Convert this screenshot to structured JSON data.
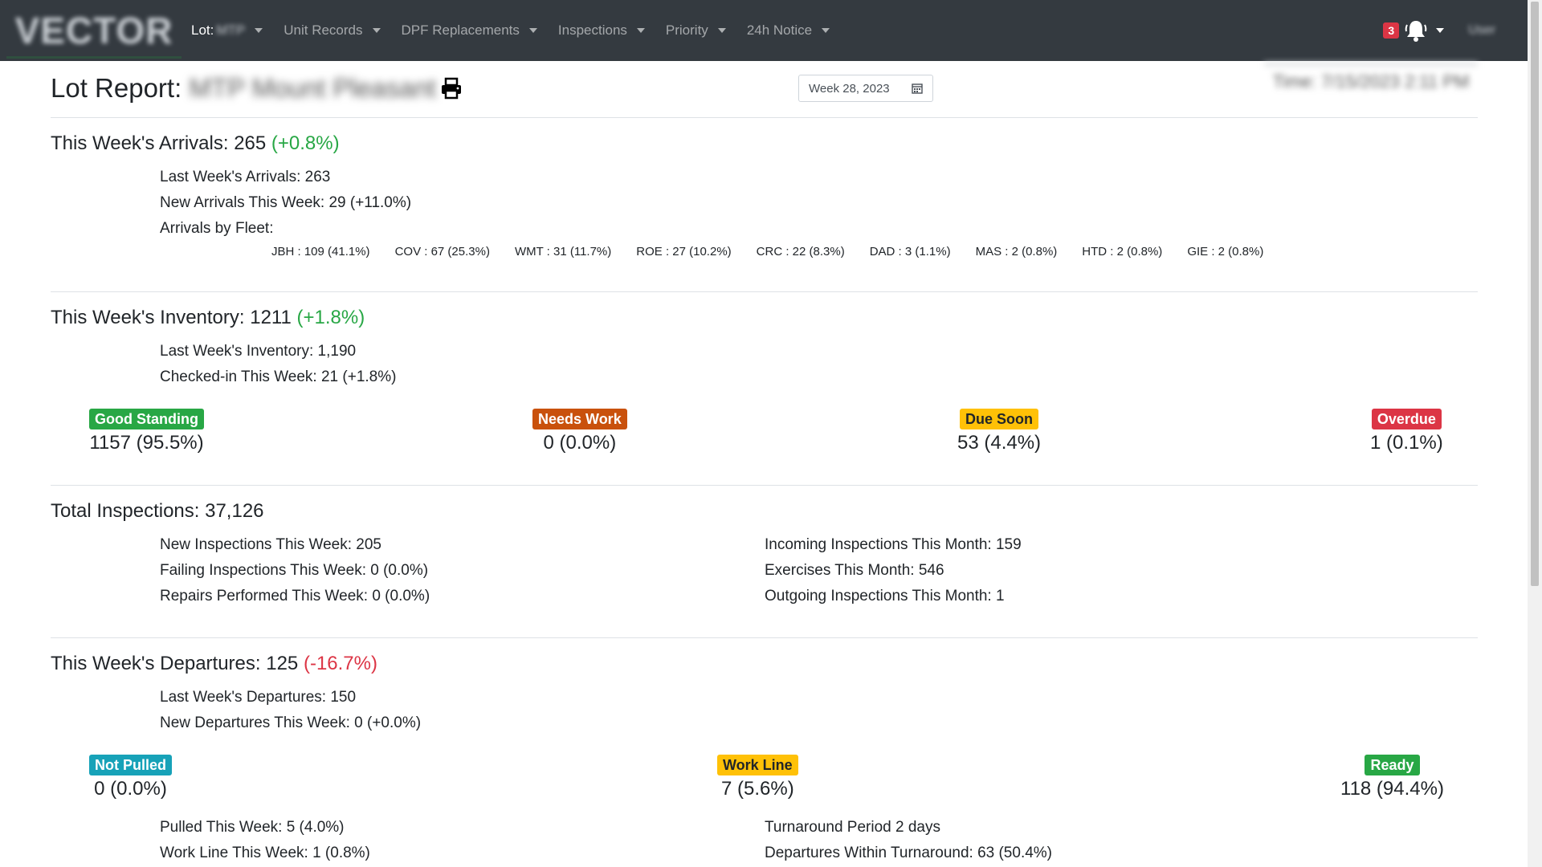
{
  "nav": {
    "brand": "VECTOR",
    "lot_label": "Lot:",
    "lot_value": "MTP",
    "menu": [
      "Unit Records",
      "DPF Replacements",
      "Inspections",
      "Priority",
      "24h Notice"
    ],
    "notification_count": "3",
    "user": "User"
  },
  "header": {
    "title": "Lot Report:",
    "lot_name": "MTP Mount Pleasant",
    "week": "Week 28, 2023",
    "time": "Time: 7/15/2023 2:11 PM"
  },
  "arrivals": {
    "title": "This Week's Arrivals: 265",
    "change": "(+0.8%)",
    "last_week": "Last Week's Arrivals: 263",
    "new": "New Arrivals This Week: 29 (+11.0%)",
    "by_fleet_label": "Arrivals by Fleet:",
    "fleets": [
      "JBH : 109 (41.1%)",
      "COV : 67 (25.3%)",
      "WMT : 31 (11.7%)",
      "ROE : 27 (10.2%)",
      "CRC : 22 (8.3%)",
      "DAD : 3 (1.1%)",
      "MAS : 2 (0.8%)",
      "HTD : 2 (0.8%)",
      "GIE : 2 (0.8%)"
    ]
  },
  "inventory": {
    "title": "This Week's Inventory: 1211",
    "change": "(+1.8%)",
    "last_week": "Last Week's Inventory: 1,190",
    "checked_in": "Checked-in This Week: 21 (+1.8%)",
    "stats": [
      {
        "label": "Good Standing",
        "value": "1157 (95.5%)"
      },
      {
        "label": "Needs Work",
        "value": "0 (0.0%)"
      },
      {
        "label": "Due Soon",
        "value": "53 (4.4%)"
      },
      {
        "label": "Overdue",
        "value": "1 (0.1%)"
      }
    ]
  },
  "inspections": {
    "title": "Total Inspections: 37,126",
    "left": [
      "New Inspections This Week: 205",
      "Failing Inspections This Week: 0 (0.0%)",
      "Repairs Performed This Week: 0 (0.0%)"
    ],
    "right": [
      "Incoming Inspections This Month: 159",
      "Exercises This Month: 546",
      "Outgoing Inspections This Month: 1"
    ]
  },
  "departures": {
    "title": "This Week's Departures: 125",
    "change": "(-16.7%)",
    "last_week": "Last Week's Departures: 150",
    "new": "New Departures This Week: 0 (+0.0%)",
    "stats": [
      {
        "label": "Not Pulled",
        "value": "0 (0.0%)"
      },
      {
        "label": "Work Line",
        "value": "7 (5.6%)"
      },
      {
        "label": "Ready",
        "value": "118 (94.4%)"
      }
    ],
    "left": [
      "Pulled This Week: 5 (4.0%)",
      "Work Line This Week: 1 (0.8%)"
    ],
    "right": [
      "Turnaround Period 2 days",
      "Departures Within Turnaround: 63 (50.4%)"
    ]
  },
  "colors": {
    "navbar": "#343a40",
    "positive": "#28a745",
    "negative": "#dc3545",
    "good": "#28a745",
    "needs_work": "#c9510c",
    "due_soon": "#ffc107",
    "overdue": "#dc3545",
    "not_pulled": "#17a2b8"
  }
}
